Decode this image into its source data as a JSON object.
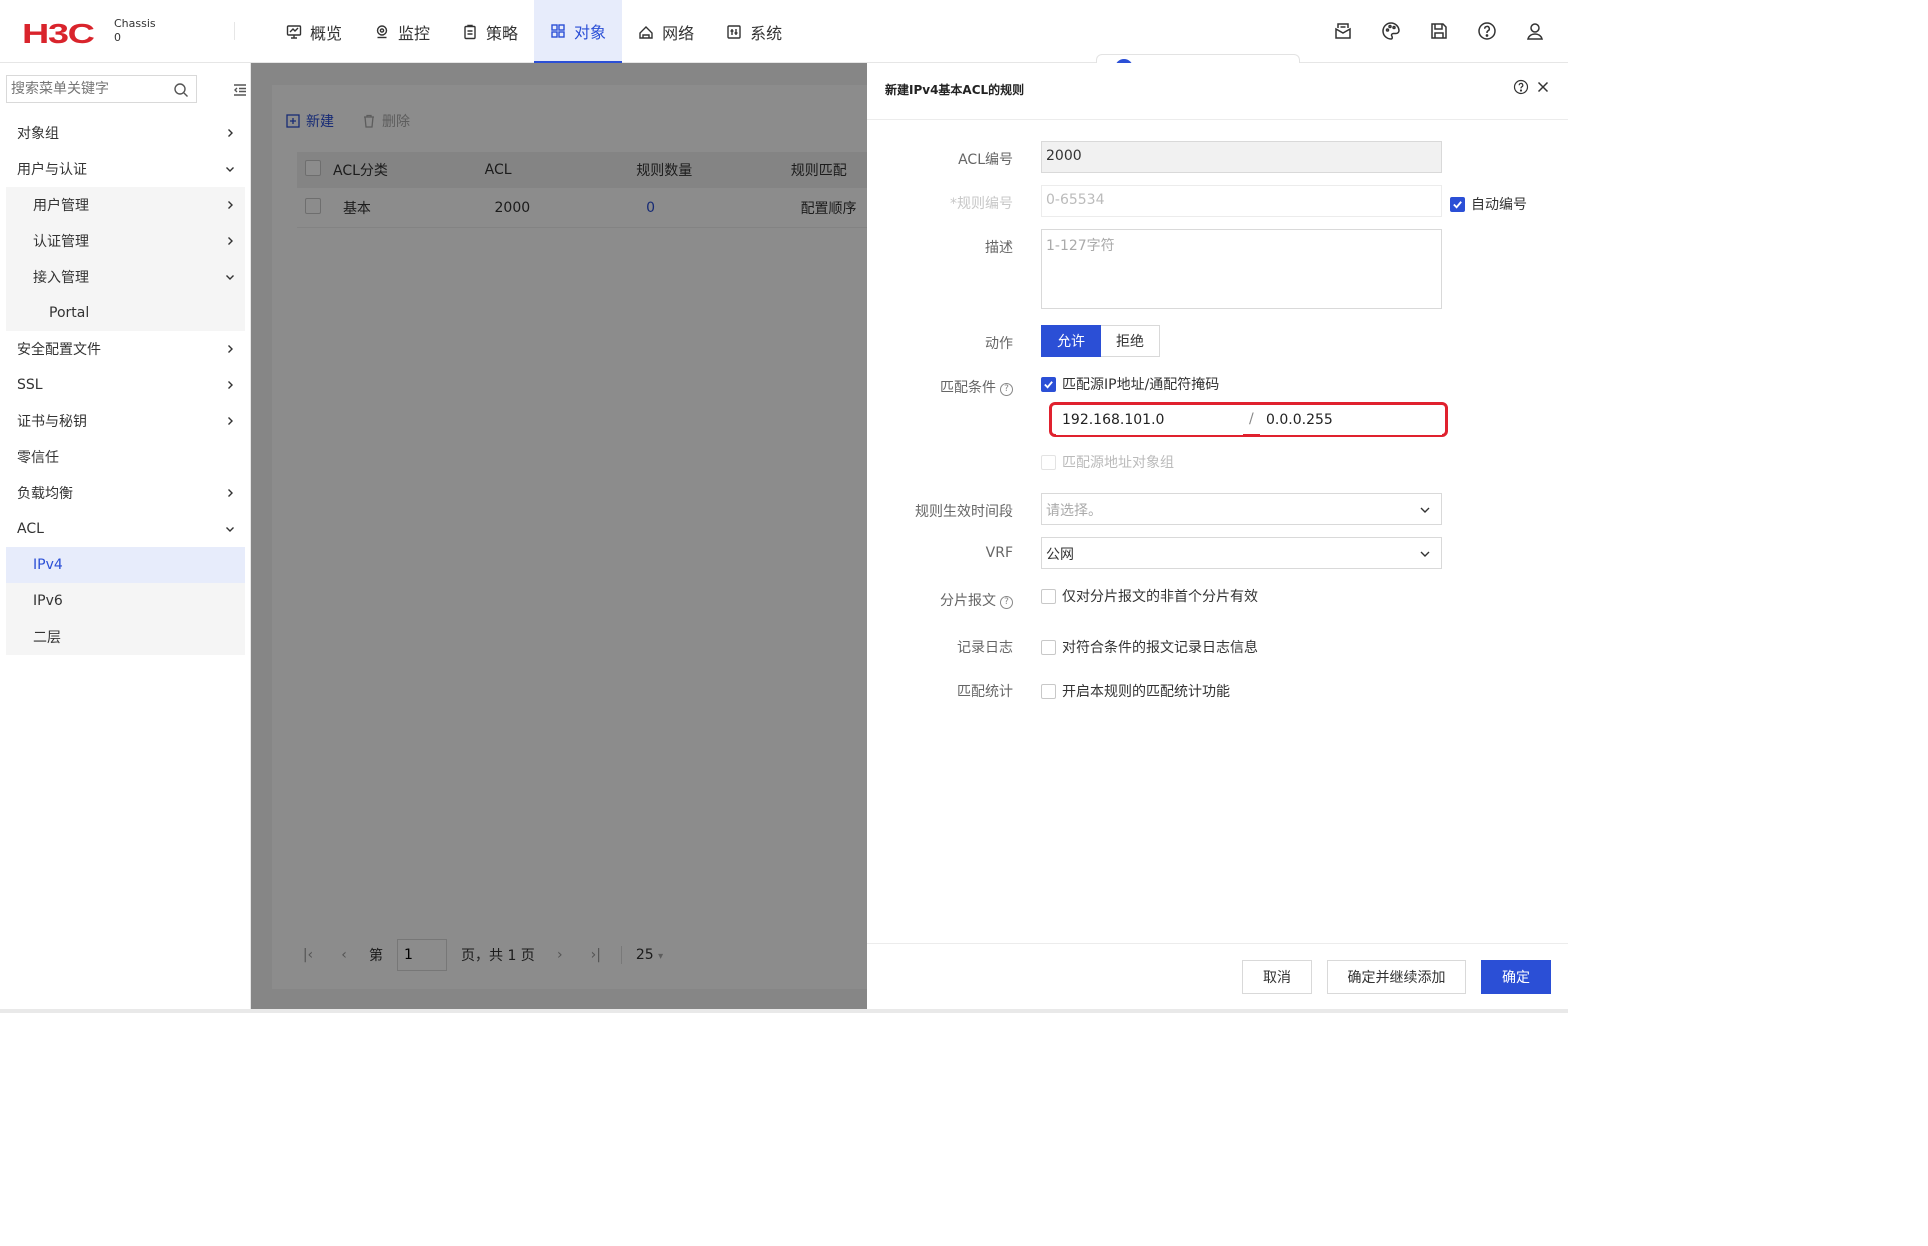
{
  "brand": {
    "logo": "H3C",
    "chassis_label": "Chassis",
    "chassis_value": "0"
  },
  "nav": [
    {
      "label": "概览",
      "icon": "monitor-icon"
    },
    {
      "label": "监控",
      "icon": "location-pin-icon"
    },
    {
      "label": "策略",
      "icon": "clipboard-icon"
    },
    {
      "label": "对象",
      "icon": "grid-icon",
      "active": true
    },
    {
      "label": "网络",
      "icon": "network-icon"
    },
    {
      "label": "系统",
      "icon": "system-icon"
    }
  ],
  "top_icons": [
    "mail-icon",
    "palette-icon",
    "save-icon",
    "help-icon",
    "user-icon"
  ],
  "sidebar": {
    "search_placeholder": "搜索菜单关键字",
    "items": [
      {
        "label": "对象组"
      },
      {
        "label": "用户与认证"
      },
      {
        "label": "用户管理"
      },
      {
        "label": "认证管理"
      },
      {
        "label": "接入管理"
      },
      {
        "label": "Portal"
      },
      {
        "label": "安全配置文件"
      },
      {
        "label": "SSL"
      },
      {
        "label": "证书与秘钥"
      },
      {
        "label": "零信任"
      },
      {
        "label": "负载均衡"
      },
      {
        "label": "ACL"
      },
      {
        "label": "IPv4"
      },
      {
        "label": "IPv6"
      },
      {
        "label": "二层"
      }
    ]
  },
  "main": {
    "toolbar": {
      "new_label": "新建",
      "delete_label": "删除"
    },
    "table": {
      "headers": [
        "ACL分类",
        "ACL",
        "规则数量",
        "规则匹配"
      ],
      "rows": [
        {
          "type": "基本",
          "acl": "2000",
          "count": "0",
          "match": "配置顺序"
        }
      ]
    },
    "pager": {
      "prefix": "第",
      "page": "1",
      "suffix": "页，共 1 页",
      "page_size": "25"
    }
  },
  "dialog": {
    "title": "新建IPv4基本ACL的规则",
    "acl_number_label": "ACL编号",
    "acl_number_value": "2000",
    "rule_number_label": "*规则编号",
    "rule_number_placeholder": "0-65534",
    "auto_number_label": "自动编号",
    "desc_label": "描述",
    "desc_placeholder": "1-127字符",
    "action_label": "动作",
    "action_permit": "允许",
    "action_deny": "拒绝",
    "match_label": "匹配条件",
    "match_src_ip_label": "匹配源IP地址/通配符掩码",
    "src_ip": "192.168.101.0",
    "wildcard": "0.0.0.255",
    "match_src_obj_label": "匹配源地址对象组",
    "time_range_label": "规则生效时间段",
    "time_range_placeholder": "请选择。",
    "vrf_label": "VRF",
    "vrf_value": "公网",
    "fragment_label": "分片报文",
    "fragment_option": "仅对分片报文的非首个分片有效",
    "log_label": "记录日志",
    "log_option": "对符合条件的报文记录日志信息",
    "stats_label": "匹配统计",
    "stats_option": "开启本规则的匹配统计功能",
    "cancel": "取消",
    "confirm_continue": "确定并继续添加",
    "confirm": "确定"
  },
  "colors": {
    "accent": "#2b4fd6",
    "brand_red": "#d9242c",
    "highlight_red": "#e0212e"
  }
}
